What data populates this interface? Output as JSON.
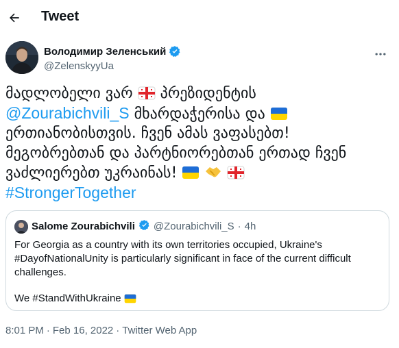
{
  "header": {
    "title": "Tweet"
  },
  "author": {
    "name": "Володимир Зеленський",
    "handle": "@ZelenskyyUa"
  },
  "tweet": {
    "line1_text": "მადლობელი ვარ ",
    "line1_text2": " პრეზიდენტის",
    "mention": "@Zourabichvili_S",
    "line2_text": " მხარდაჭერისა და ",
    "line3_text": "ერთიანობისთვის. ჩვენ ამას ვაფასებთ!",
    "line4_text": "მეგობრებთან და პარტნიორებთან ერთად ჩვენ",
    "line5_text": "ვაძლიერებთ უკრაინას! ",
    "hashtag": "#StrongerTogether"
  },
  "quote": {
    "name": "Salome Zourabichvili",
    "handle": "@Zourabichvili_S",
    "dot": "·",
    "time": "4h",
    "body": "For Georgia as a country with its own territories occupied, Ukraine's #DayofNationalUnity is particularly significant in face of the current difficult challenges.",
    "body2": "We #StandWithUkraine"
  },
  "meta": {
    "time": "8:01 PM",
    "sep1": "·",
    "date": "Feb 16, 2022",
    "sep2": "·",
    "source": "Twitter Web App"
  },
  "icons": {
    "back": "arrow-left-icon",
    "more": "more-horizontal-icon",
    "verified": "verified-badge-icon",
    "flag_georgia": "georgia-flag-icon",
    "flag_ukraine": "ukraine-flag-icon",
    "handshake": "handshake-icon"
  },
  "colors": {
    "link": "#1d9bf0",
    "secondary": "#536471",
    "border": "#cfd9de"
  }
}
